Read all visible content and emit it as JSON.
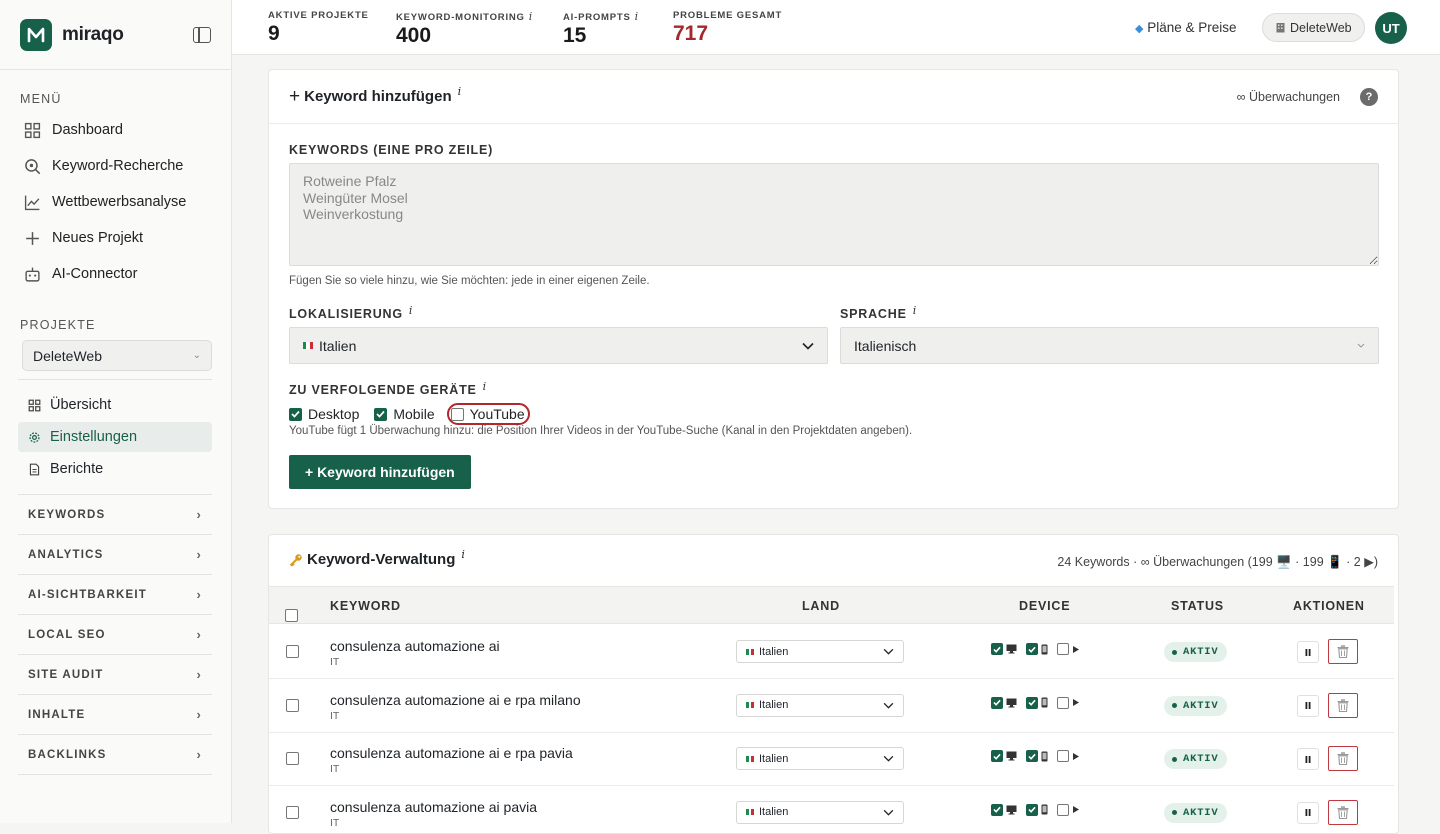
{
  "brand": {
    "name": "miraqo"
  },
  "sidebar": {
    "menu_label": "MENÜ",
    "menu_items": [
      {
        "label": "Dashboard",
        "icon": "grid-icon"
      },
      {
        "label": "Keyword-Recherche",
        "icon": "search-icon"
      },
      {
        "label": "Wettbewerbsanalyse",
        "icon": "line-chart-icon"
      },
      {
        "label": "Neues Projekt",
        "icon": "plus-icon"
      },
      {
        "label": "AI-Connector",
        "icon": "robot-icon"
      }
    ],
    "projects_label": "PROJEKTE",
    "project_selected": "DeleteWeb",
    "project_items": [
      {
        "label": "Übersicht",
        "icon": "grid-icon"
      },
      {
        "label": "Einstellungen",
        "icon": "gear-icon",
        "active": true
      },
      {
        "label": "Berichte",
        "icon": "document-icon"
      }
    ],
    "groups": [
      "KEYWORDS",
      "ANALYTICS",
      "AI-SICHTBARKEIT",
      "LOCAL SEO",
      "SITE AUDIT",
      "INHALTE",
      "BACKLINKS"
    ]
  },
  "topbar": {
    "stats": [
      {
        "label": "AKTIVE PROJEKTE",
        "value": "9",
        "info": false
      },
      {
        "label": "KEYWORD-MONITORING",
        "value": "400",
        "info": true
      },
      {
        "label": "AI-PROMPTS",
        "value": "15",
        "info": true
      },
      {
        "label": "PROBLEME GESAMT",
        "value": "717",
        "info": false,
        "alert": true
      }
    ],
    "plans_label": "Pläne & Preise",
    "workspace_label": "DeleteWeb",
    "avatar_initials": "UT"
  },
  "add_card": {
    "title": "Keyword hinzufügen",
    "monitoring_label": "∞ Überwachungen",
    "help": "?",
    "keywords_label": "KEYWORDS (EINE PRO ZEILE)",
    "keywords_placeholder": "Rotweine Pfalz\nWeingüter Mosel\nWeinverkostung",
    "keywords_hint": "Fügen Sie so viele hinzu, wie Sie möchten: jede in einer eigenen Zeile.",
    "localization_label": "LOKALISIERUNG",
    "localization_value": "Italien",
    "language_label": "SPRACHE",
    "language_value": "Italienisch",
    "devices_label": "ZU VERFOLGENDE GERÄTE",
    "devices": [
      {
        "label": "Desktop",
        "checked": true
      },
      {
        "label": "Mobile",
        "checked": true
      },
      {
        "label": "YouTube",
        "checked": false
      }
    ],
    "youtube_hint": "YouTube fügt 1 Überwachung hinzu: die Position Ihrer Videos in der YouTube-Suche (Kanal in den Projektdaten angeben).",
    "submit_label": "+ Keyword hinzufügen"
  },
  "manage_card": {
    "title": "Keyword-Verwaltung",
    "summary": "24 Keywords · ∞ Überwachungen (199 🖥️ · 199 📱 · 2 ▶)",
    "columns": {
      "keyword": "KEYWORD",
      "land": "LAND",
      "device": "DEVICE",
      "status": "STATUS",
      "actions": "AKTIONEN"
    },
    "rows": [
      {
        "keyword": "consulenza automazione ai",
        "country_code": "IT",
        "land": "Italien",
        "status": "AKTIV"
      },
      {
        "keyword": "consulenza automazione ai e rpa milano",
        "country_code": "IT",
        "land": "Italien",
        "status": "AKTIV"
      },
      {
        "keyword": "consulenza automazione ai e rpa pavia",
        "country_code": "IT",
        "land": "Italien",
        "status": "AKTIV"
      },
      {
        "keyword": "consulenza automazione ai pavia",
        "country_code": "IT",
        "land": "Italien",
        "status": "AKTIV"
      }
    ]
  },
  "colors": {
    "brand": "#17614a",
    "alert": "#a5262c",
    "highlight": "#b3262e"
  }
}
